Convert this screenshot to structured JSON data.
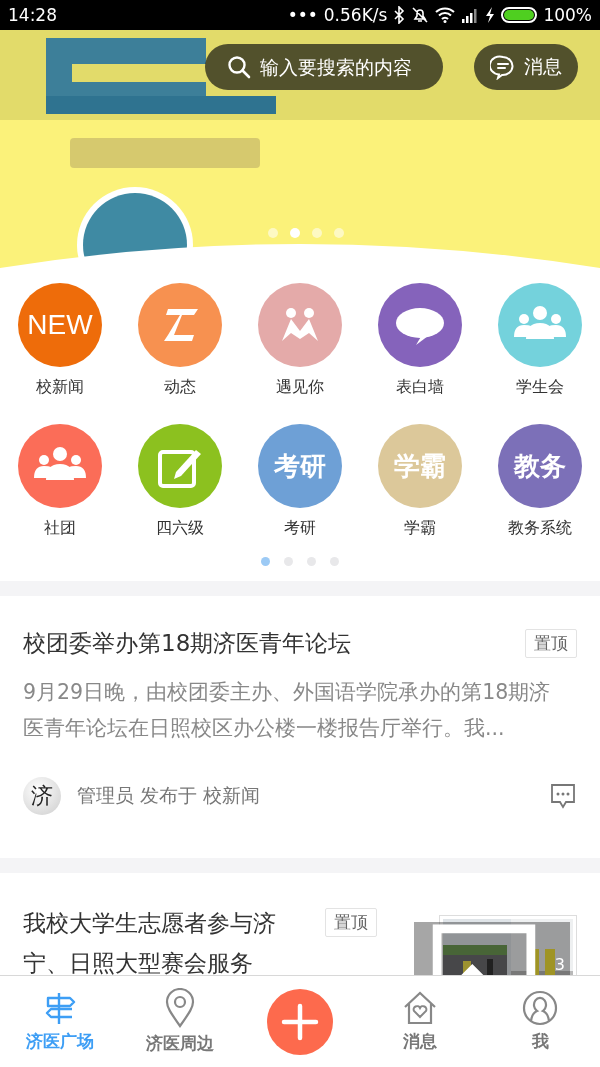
{
  "status_bar": {
    "time": "14:28",
    "dots": "•••",
    "speed": "0.56K/s",
    "battery": "100%"
  },
  "banner": {
    "kind": "picture",
    "search": {
      "placeholder": "输入要搜索的内容"
    },
    "messages_button": "消息",
    "dots": [
      {
        "selected": false
      },
      {
        "selected": true
      },
      {
        "selected": false
      },
      {
        "selected": false
      }
    ]
  },
  "apps": [
    {
      "label": "校新闻",
      "color": "#ee6c0a",
      "icon_text": "NEW"
    },
    {
      "label": "动态",
      "color": "#f79150"
    },
    {
      "label": "遇见你",
      "color": "#e4aaa9"
    },
    {
      "label": "表白墙",
      "color": "#8563bb"
    },
    {
      "label": "学生会",
      "color": "#74d2dc"
    },
    {
      "label": "社团",
      "color": "#fb6d58"
    },
    {
      "label": "四六级",
      "color": "#8cc11f"
    },
    {
      "label": "考研",
      "color": "#6ea0d6",
      "icon_text": "考研"
    },
    {
      "label": "学霸",
      "color": "#dcc89a",
      "icon_text": "学霸"
    },
    {
      "label": "教务系统",
      "color": "#7c70b8",
      "icon_text": "教务"
    }
  ],
  "app_pages": [
    {
      "selected": true
    },
    {
      "selected": false
    },
    {
      "selected": false
    },
    {
      "selected": false
    }
  ],
  "posts": [
    {
      "title": "校团委举办第18期济医青年论坛",
      "tag": "置顶",
      "excerpt": "9月29日晚，由校团委主办、外国语学院承办的第18期济医青年论坛在日照校区办公楼一楼报告厅举行。我...",
      "avatar": "济",
      "author": "管理员 发布于 校新闻"
    },
    {
      "title": "我校大学生志愿者参与济宁、日照大型赛会服务",
      "tag": "置顶",
      "image_count": "3"
    }
  ],
  "tab_bar": [
    {
      "kind": "tab",
      "label": "济医广场",
      "selected": true
    },
    {
      "kind": "tab",
      "label": "济医周边",
      "selected": false
    },
    {
      "kind": "add"
    },
    {
      "kind": "tab",
      "label": "消息",
      "selected": false
    },
    {
      "kind": "tab",
      "label": "我",
      "selected": false
    }
  ]
}
